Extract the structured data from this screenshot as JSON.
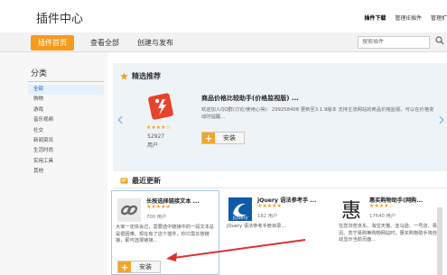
{
  "header": {
    "title": "插件中心",
    "links": [
      "插件下载",
      "管理IE插件",
      "管理扩"
    ]
  },
  "nav": {
    "tabs": [
      "插件首页",
      "查看全部",
      "创建与发布"
    ],
    "search_placeholder": "搜索插件"
  },
  "sidebar": {
    "title": "分类",
    "categories": [
      "全部",
      "购物",
      "游戏",
      "音乐视频",
      "社交",
      "新闻资讯",
      "生活时尚",
      "实用工具",
      "其他"
    ]
  },
  "featured": {
    "heading": "精选推荐",
    "name": "商品价格比较助手(价格监视版) ...",
    "description": "欢迎加入QQ群(讨论/使用心得)：299258408 更新至3.1.9版本 支持主流网站的商品价格监视，可以在价格变动时提醒...",
    "users_count": "52927",
    "users_label": "用户",
    "rating": "★★★★☆",
    "install_label": "安装"
  },
  "latest": {
    "heading": "最近更新",
    "cards": [
      {
        "name": "长按选择链接文本 ...",
        "rating": "★★★★★",
        "users": "700 用户",
        "description": "大家一定体会过，需要选中链接中的一段文本总是很困难，现在有了这个插件，你只需长按链接，即可选择链接...",
        "install_label": "安装"
      },
      {
        "name": "jQuery 语法参考手 ...",
        "rating": "★★★★★",
        "users": "182 用户",
        "description": "jQuery 语法参考手册目录..."
      },
      {
        "name": "惠买购物助手(网购...",
        "rating": "★★★★☆",
        "users": "17640 用户",
        "description": "在您浏览京东、淘宝天猫、亚马逊、一号店、易迅、苏宁易购等购物网站时，惠买购物助手将自动显示当前页面..."
      }
    ]
  },
  "colors": {
    "accent": "#f79a1e",
    "star": "#f1a21b",
    "featured_bg": "#eef3f8",
    "arrow": "#e03030"
  }
}
